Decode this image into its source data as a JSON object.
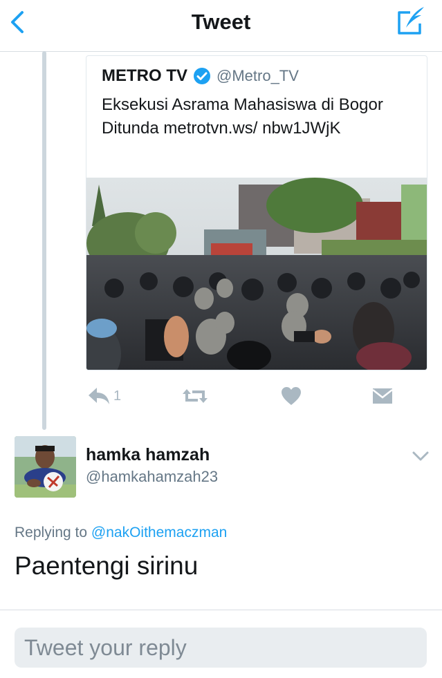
{
  "header": {
    "title": "Tweet"
  },
  "quoted_tweet": {
    "name": "METRO TV",
    "handle": "@Metro_TV",
    "verified": true,
    "text": "Eksekusi Asrama Mahasiswa di Bogor Ditunda metrotvn.ws/ nbw1JWjK",
    "media": "photo-crowd-police"
  },
  "actions": {
    "reply_count": "1",
    "icons": [
      "reply-icon",
      "retweet-icon",
      "like-icon",
      "dm-icon"
    ]
  },
  "reply": {
    "author_name": "hamka hamzah",
    "author_handle": "@hamkahamzah23",
    "replying_prefix": "Replying to ",
    "replying_to": "@nakOithemaczman",
    "text": "Paentengi sirinu"
  },
  "composer": {
    "placeholder": "Tweet your reply"
  },
  "colors": {
    "accent": "#1da1f2",
    "verified": "#1da1f2",
    "muted": "#657786",
    "icon_gray": "#aab8c2"
  }
}
